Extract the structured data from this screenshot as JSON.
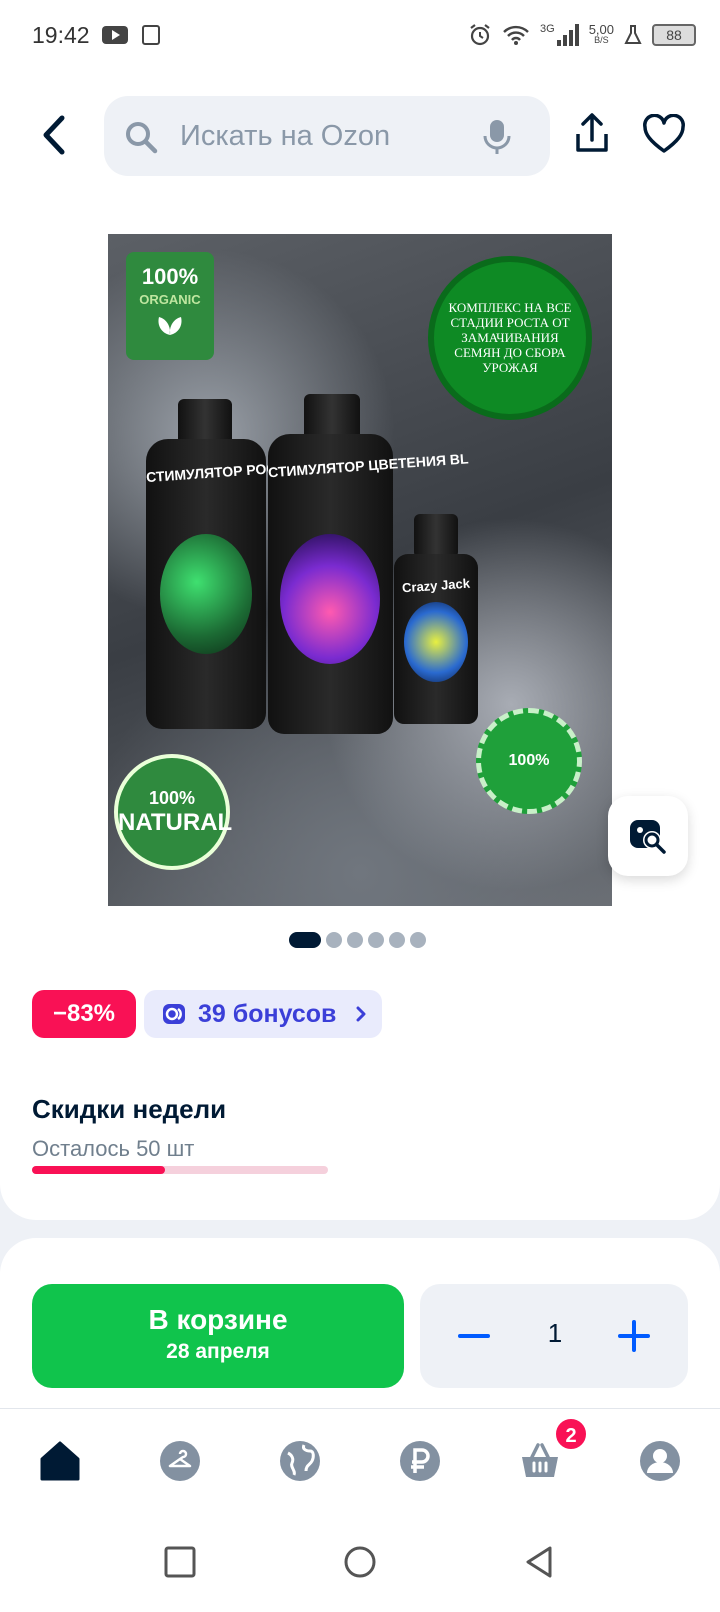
{
  "status_bar": {
    "time": "19:42",
    "network_type": "3G",
    "speed_value": "5,00",
    "speed_unit": "B/S",
    "battery": "88"
  },
  "header": {
    "search_placeholder": "Искать на Ozon"
  },
  "product_image": {
    "organic_badge_top": "100%",
    "organic_badge_bottom": "ORGANIC",
    "seal_text": "КОМПЛЕКС НА ВСЕ СТАДИИ РОСТА ОТ ЗАМАЧИВАНИЯ СЕМЯН ДО СБОРА УРОЖАЯ",
    "bottle1_label": "СТИМУЛЯТОР РОСТА GROW",
    "bottle2_label": "СТИМУЛЯТОР ЦВЕТЕНИЯ BL",
    "bottle3_label": "Crazy Jack",
    "natural_badge_top": "100%",
    "natural_badge_bottom": "NATURAL",
    "eco_badge_text": "100%",
    "pager": {
      "total": 6,
      "active": 1
    }
  },
  "discount": {
    "percent": "−83%",
    "bonus_label": "39 бонусов"
  },
  "deal": {
    "title": "Скидки недели",
    "remaining": "Осталось 50 шт",
    "remaining_fraction": 0.45
  },
  "buy": {
    "cart_label": "В корзине",
    "delivery_date": "28 апреля",
    "quantity": "1"
  },
  "bottom_nav": {
    "items": [
      "home-icon",
      "hanger-icon",
      "globe-icon",
      "ruble-icon",
      "basket-icon",
      "profile-icon"
    ],
    "cart_badge": "2"
  },
  "colors": {
    "accent_red": "#f91155",
    "cart_green": "#10c44c",
    "bonus_blue": "#3b3fd8",
    "qty_blue": "#005bff"
  }
}
